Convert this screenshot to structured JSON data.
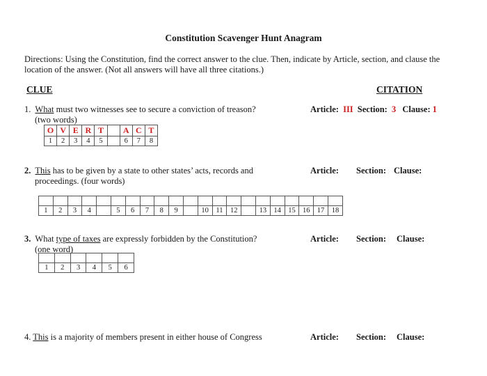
{
  "title": "Constitution Scavenger Hunt Anagram",
  "directions": "Directions: Using the Constitution, find the correct answer to the clue. Then, indicate by Article, section, and clause the location of the answer. (Not all answers will have all three citations.)",
  "headers": {
    "clue": "CLUE",
    "citation": "CITATION"
  },
  "labels": {
    "article": "Article:",
    "section": "Section:",
    "clause": "Clause:"
  },
  "colors": {
    "answer": "#cc1f1f"
  },
  "questions": [
    {
      "number": "1.",
      "underlined": "What",
      "text_after": " must two witnesses see to secure a conviction of treason?",
      "hint": "(two words)",
      "letters": [
        "O",
        "V",
        "E",
        "R",
        "T",
        "",
        "A",
        "C",
        "T"
      ],
      "numbers": [
        "1",
        "2",
        "3",
        "4",
        "5",
        "",
        "6",
        "7",
        "8"
      ],
      "article": "III",
      "section": "3",
      "clause": "1"
    },
    {
      "number": "2.",
      "underlined": "This",
      "text_after": " has to be given by a state to other states’ acts, records and",
      "line2": "proceedings. (four words)",
      "numbers": [
        "1",
        "2",
        "3",
        "4",
        "",
        "5",
        "6",
        "7",
        "8",
        "9",
        "",
        "10",
        "11",
        "12",
        "",
        "13",
        "14",
        "15",
        "16",
        "17",
        "18"
      ],
      "article": "",
      "section": "",
      "clause": ""
    },
    {
      "number": "3.",
      "text_before": "What ",
      "underlined": "type of taxes",
      "text_after": " are expressly forbidden by the Constitution?",
      "hint": "(one word)",
      "numbers": [
        "1",
        "2",
        "3",
        "4",
        "5",
        "6"
      ],
      "article": "",
      "section": "",
      "clause": ""
    },
    {
      "number": "4.",
      "underlined": "This",
      "text_after": " is a majority of members present in either house of Congress",
      "article": "",
      "section": "",
      "clause": ""
    }
  ]
}
